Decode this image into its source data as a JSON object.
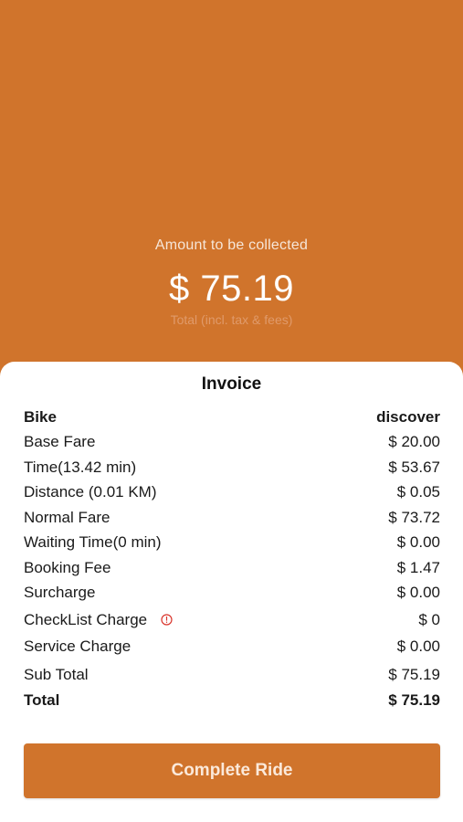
{
  "header": {
    "caption": "Amount to be collected",
    "amount": "$ 75.19",
    "subcaption": "Total (incl. tax & fees)"
  },
  "invoice": {
    "title": "Invoice",
    "vehicle_label": "Bike",
    "vehicle_value": "discover",
    "rows": [
      {
        "label": "Base Fare",
        "value": "$ 20.00"
      },
      {
        "label": "Time(13.42 min)",
        "value": "$ 53.67"
      },
      {
        "label": "Distance (0.01 KM)",
        "value": "$ 0.05"
      },
      {
        "label": "Normal Fare",
        "value": "$ 73.72"
      },
      {
        "label": "Waiting Time(0 min)",
        "value": "$ 0.00"
      },
      {
        "label": "Booking Fee",
        "value": "$ 1.47"
      },
      {
        "label": "Surcharge",
        "value": "$ 0.00"
      },
      {
        "label": "CheckList Charge",
        "value": "$ 0",
        "icon": "info-circle-icon"
      },
      {
        "label": "Service Charge",
        "value": "$ 0.00"
      }
    ],
    "subtotal_label": "Sub Total",
    "subtotal_value": "$ 75.19",
    "total_label": "Total",
    "total_value": "$ 75.19"
  },
  "actions": {
    "complete_label": "Complete Ride"
  },
  "colors": {
    "accent": "#d0742c",
    "info_icon": "#d9342b"
  }
}
